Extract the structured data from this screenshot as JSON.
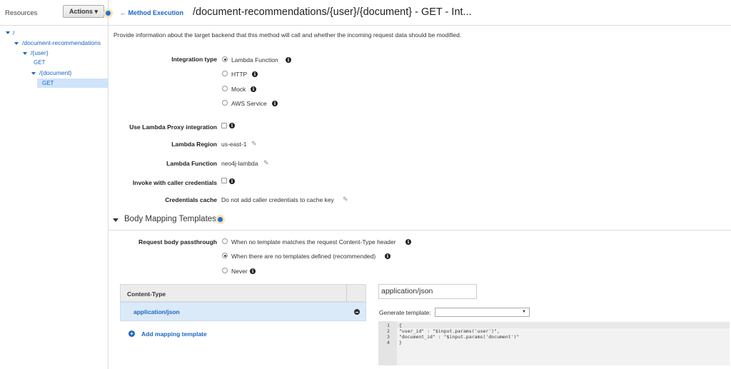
{
  "sidebar": {
    "title": "Resources",
    "actions_label": "Actions",
    "tree": [
      "/",
      "/document-recommendations",
      "/{user}",
      "GET",
      "/{document}",
      "GET"
    ]
  },
  "header": {
    "back_link": "Method Execution",
    "title": "/document-recommendations/{user}/{document} - GET - Int..."
  },
  "description": "Provide information about the target backend that this method will call and whether the incoming request data should be modified.",
  "integration": {
    "type_label": "Integration type",
    "options": [
      "Lambda Function",
      "HTTP",
      "Mock",
      "AWS Service"
    ],
    "selected": "Lambda Function",
    "proxy_label": "Use Lambda Proxy integration",
    "region_label": "Lambda Region",
    "region_value": "us-east-1",
    "function_label": "Lambda Function",
    "function_value": "neo4j-lambda",
    "invoke_label": "Invoke with caller credentials",
    "cache_label": "Credentials cache",
    "cache_value": "Do not add caller credentials to cache key"
  },
  "body_mapping": {
    "section_title": "Body Mapping Templates",
    "passthrough_label": "Request body passthrough",
    "options": [
      "When no template matches the request Content-Type header",
      "When there are no templates defined (recommended)",
      "Never"
    ],
    "selected": "When there are no templates defined (recommended)",
    "content_type_header": "Content-Type",
    "content_types": [
      "application/json"
    ],
    "add_label": "Add mapping template",
    "content_type_input": "application/json",
    "generate_label": "Generate template:",
    "generate_selected": "",
    "code_lines": [
      {
        "n": "1",
        "text": "{"
      },
      {
        "n": "2",
        "text": "\"user_id\" : \"$input.params('user')\","
      },
      {
        "n": "3",
        "text": "\"document_id\" : \"$input.params('document')\""
      },
      {
        "n": "4",
        "text": "}"
      }
    ]
  },
  "colors": {
    "link": "#1a66c1",
    "selected_row": "#dbeaf8",
    "hint_ring": "#ffe3b3"
  },
  "icons": [
    "caret-down-icon",
    "back-arrow-icon",
    "info-icon",
    "pencil-icon",
    "minus-circle-icon",
    "plus-circle-icon",
    "hint-dot-icon"
  ]
}
